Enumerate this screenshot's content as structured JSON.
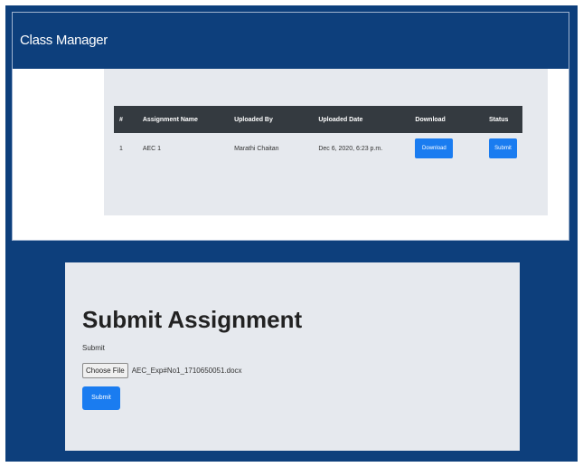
{
  "app": {
    "title": "Class Manager"
  },
  "table": {
    "headers": [
      "#",
      "Assignment Name",
      "Uploaded By",
      "Uploaded Date",
      "Download",
      "Status"
    ],
    "rows": [
      {
        "index": "1",
        "name": "AEC 1",
        "uploaded_by": "Marathi Chaitan",
        "uploaded_date": "Dec 6, 2020, 6:23 p.m.",
        "download_label": "Download",
        "status_label": "Submit"
      }
    ]
  },
  "submit_form": {
    "title": "Submit Assignment",
    "field_label": "Submit",
    "choose_file_label": "Choose File",
    "file_name": "AEC_Exp#No1_1710650051.docx",
    "submit_label": "Submit"
  },
  "colors": {
    "navbar": "#0d3f7c",
    "table_header": "#343a40",
    "primary_button": "#1a7cf0",
    "card_background": "#e6e9ee"
  }
}
